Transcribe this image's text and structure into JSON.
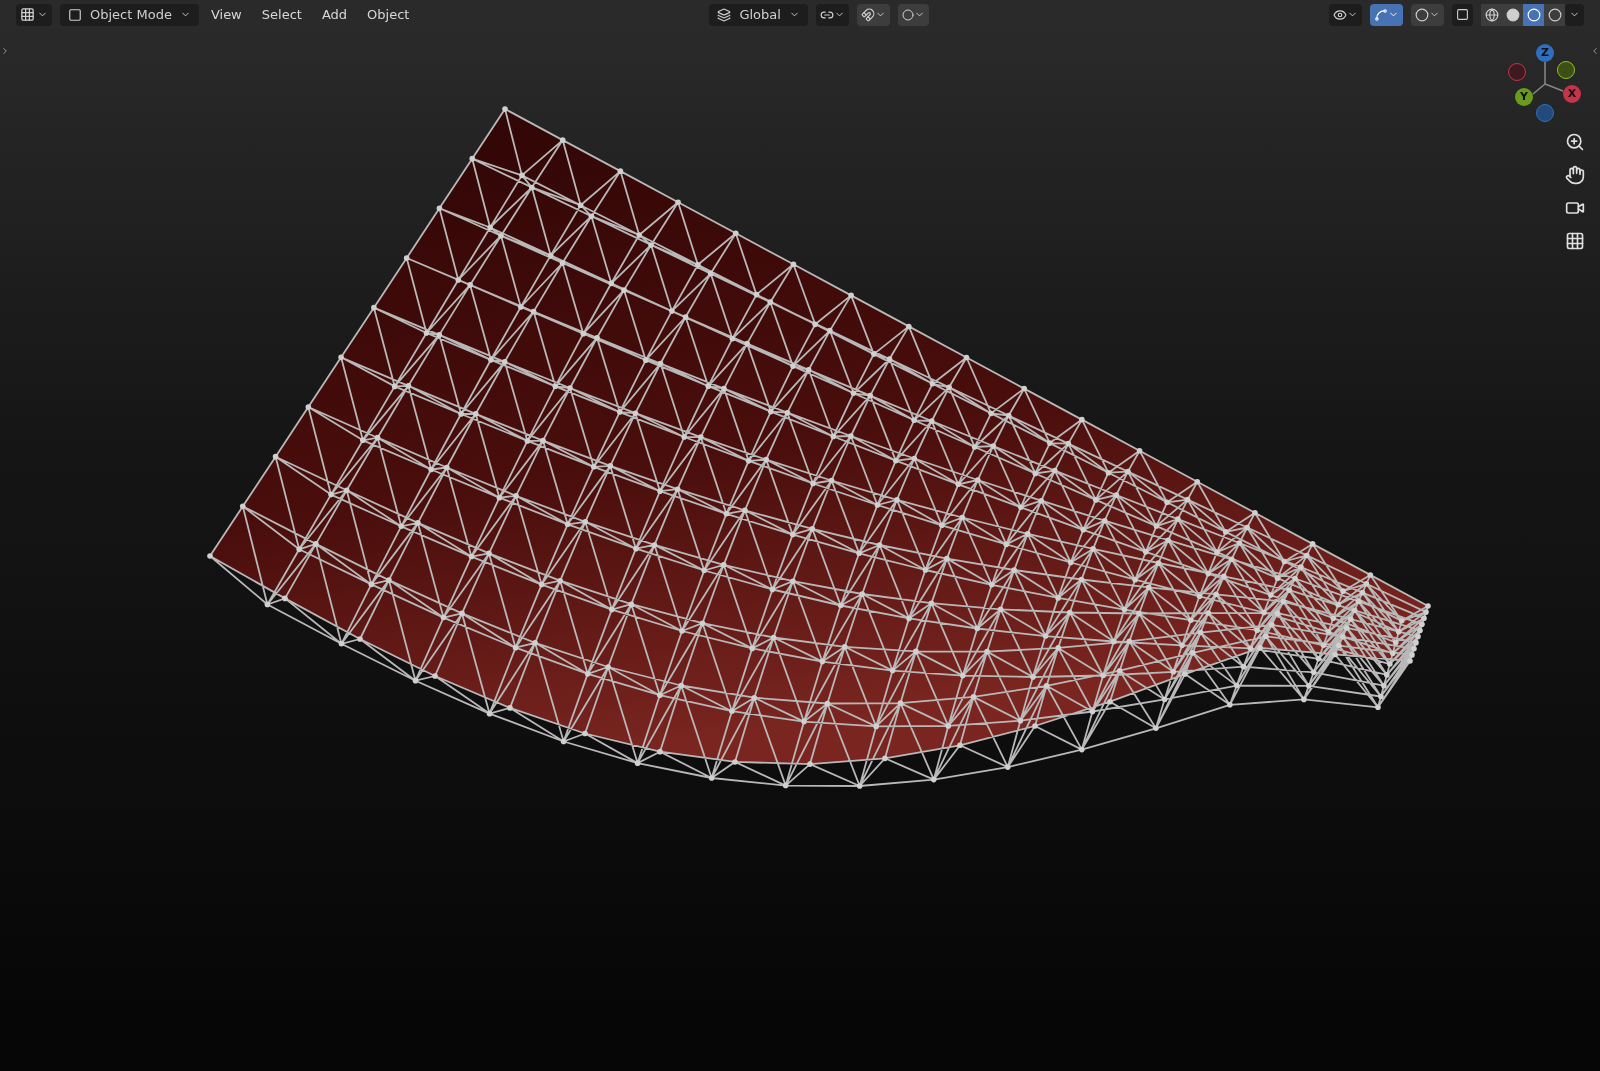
{
  "header": {
    "mode": "Object Mode",
    "menus": [
      "View",
      "Select",
      "Add",
      "Object"
    ],
    "orientation": "Global",
    "gizmos_on": true,
    "overlays_on": false,
    "xray_on": false,
    "shading": [
      {
        "kind": "wireframe",
        "selected": false
      },
      {
        "kind": "solid",
        "selected": false
      },
      {
        "kind": "material",
        "selected": true
      },
      {
        "kind": "rendered",
        "selected": false
      }
    ]
  },
  "gizmo": {
    "axes": [
      {
        "label": "Z",
        "color": "#2f6fbf"
      },
      {
        "label": "X",
        "color": "#c4344a"
      },
      {
        "label": "Y",
        "color": "#6a9a1e"
      }
    ]
  }
}
